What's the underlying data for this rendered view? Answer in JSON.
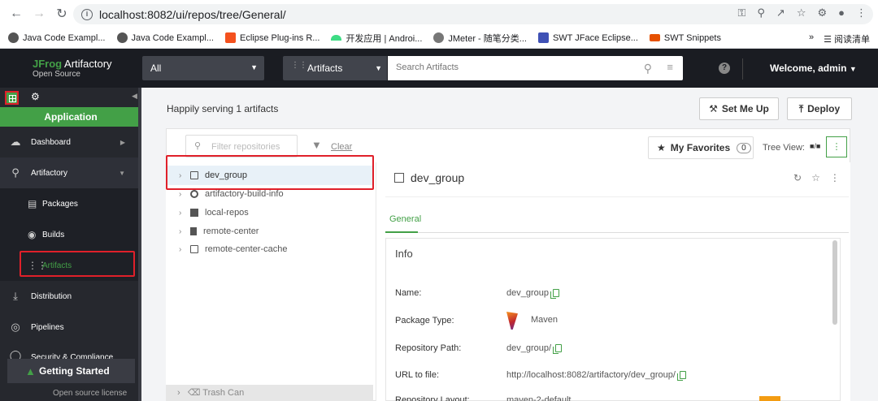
{
  "browser": {
    "url": "localhost:8082/ui/repos/tree/General/",
    "bookmarks": [
      {
        "label": "Java Code Exampl...",
        "color": "#555555"
      },
      {
        "label": "Java Code Exampl...",
        "color": "#555555"
      },
      {
        "label": "Eclipse Plug-ins R...",
        "color": "#f4511e"
      },
      {
        "label": "开发应用 | Androi...",
        "color": "#3ddc84"
      },
      {
        "label": "JMeter - 随笔分类...",
        "color": "#555555"
      },
      {
        "label": "SWT JFace Eclipse...",
        "color": "#3f51b5"
      },
      {
        "label": "SWT Snippets",
        "color": "#e65100"
      }
    ],
    "more_bookmarks": "»",
    "reading_list": "阅读清单"
  },
  "topbar": {
    "logo_brand": "JFrog",
    "logo_product": "Artifactory",
    "logo_sub": "Open Source",
    "scope_select": "All",
    "search_type": "Artifacts",
    "search_placeholder": "Search Artifacts",
    "help": "?",
    "welcome": "Welcome, admin"
  },
  "sidebar": {
    "app_tab": "Application",
    "items": [
      {
        "label": "Dashboard",
        "icon": "dashboard-icon"
      },
      {
        "label": "Artifactory",
        "icon": "artifactory-icon"
      },
      {
        "label": "Distribution",
        "icon": "distribution-icon"
      },
      {
        "label": "Pipelines",
        "icon": "pipelines-icon"
      },
      {
        "label": "Security & Compliance",
        "icon": "shield-icon"
      }
    ],
    "sub_items": [
      {
        "label": "Packages",
        "icon": "packages-icon"
      },
      {
        "label": "Builds",
        "icon": "builds-icon"
      },
      {
        "label": "Artifacts",
        "icon": "artifacts-icon"
      }
    ],
    "getting_started": "Getting Started",
    "license": "Open source license"
  },
  "main": {
    "serving_text": "Happily serving 1 artifacts",
    "set_me_up": "Set Me Up",
    "deploy": "Deploy",
    "filter_placeholder": "Filter repositories",
    "clear": "Clear",
    "tree": [
      {
        "label": "dev_group"
      },
      {
        "label": "artifactory-build-info"
      },
      {
        "label": "local-repos"
      },
      {
        "label": "remote-center"
      },
      {
        "label": "remote-center-cache"
      }
    ],
    "trash": "Trash Can",
    "my_favorites": "My Favorites",
    "favorites_count": "0",
    "tree_view": "Tree View:"
  },
  "detail": {
    "title": "dev_group",
    "tab": "General",
    "info_title": "Info",
    "fields": [
      {
        "key": "Name:",
        "value": "dev_group",
        "copy": true
      },
      {
        "key": "Package Type:",
        "value": "Maven",
        "copy": false
      },
      {
        "key": "Repository Path:",
        "value": "dev_group/",
        "copy": true
      },
      {
        "key": "URL to file:",
        "value": "http://localhost:8082/artifactory/dev_group/",
        "copy": true
      },
      {
        "key": "Repository Layout:",
        "value": "maven-2-default",
        "copy": false
      }
    ]
  },
  "colors": {
    "brand_green": "#43a047",
    "highlight_red": "#e0202a",
    "topbar_bg": "#1a1c22",
    "sidebar_bg": "#26282e"
  }
}
